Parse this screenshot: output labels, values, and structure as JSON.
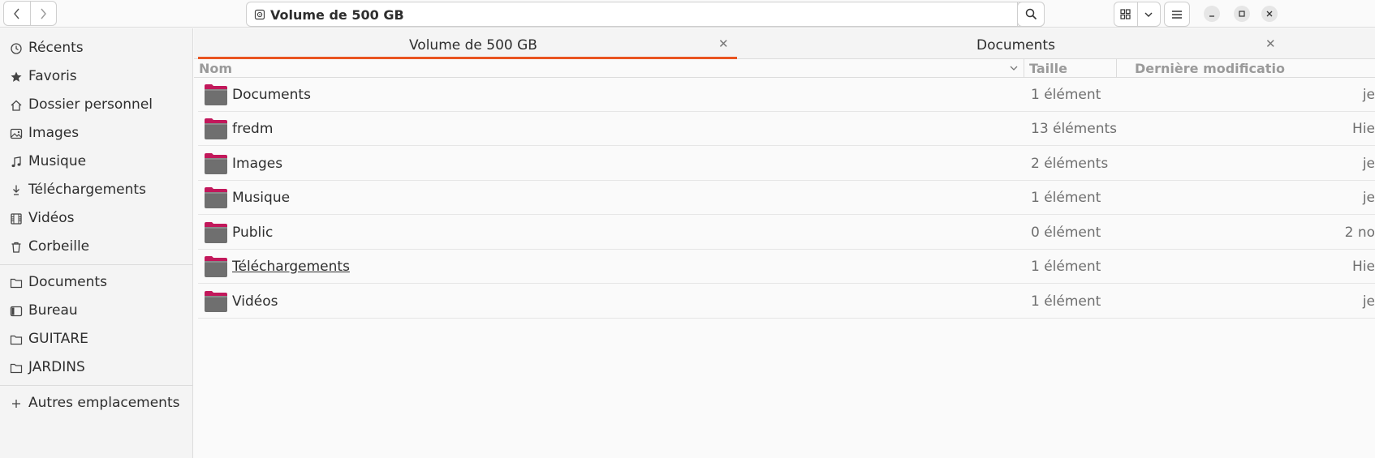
{
  "headerbar": {
    "path_label": "Volume de 500 GB"
  },
  "sidebar": {
    "items": [
      {
        "label": "Récents",
        "icon": "clock-icon"
      },
      {
        "label": "Favoris",
        "icon": "star-icon"
      },
      {
        "label": "Dossier personnel",
        "icon": "home-icon"
      },
      {
        "label": "Images",
        "icon": "image-icon"
      },
      {
        "label": "Musique",
        "icon": "music-icon"
      },
      {
        "label": "Téléchargements",
        "icon": "download-icon"
      },
      {
        "label": "Vidéos",
        "icon": "film-icon"
      },
      {
        "label": "Corbeille",
        "icon": "trash-icon"
      }
    ],
    "bookmarks": [
      {
        "label": "Documents",
        "icon": "folder-icon"
      },
      {
        "label": "Bureau",
        "icon": "desktop-icon"
      },
      {
        "label": "GUITARE",
        "icon": "folder-icon"
      },
      {
        "label": "JARDINS",
        "icon": "folder-icon"
      }
    ],
    "other_locations": {
      "label": "Autres emplacements",
      "icon": "plus-icon"
    }
  },
  "tabs": [
    {
      "label": "Volume de 500 GB",
      "active": true
    },
    {
      "label": "Documents",
      "active": false
    }
  ],
  "columns": {
    "name": "Nom",
    "size": "Taille",
    "modified": "Dernière modificatio"
  },
  "files": [
    {
      "name": "Documents",
      "size": "1 élément",
      "modified": "je"
    },
    {
      "name": "fredm",
      "size": "13 éléments",
      "modified": "Hie"
    },
    {
      "name": "Images",
      "size": "2 éléments",
      "modified": "je"
    },
    {
      "name": "Musique",
      "size": "1 élément",
      "modified": "je"
    },
    {
      "name": "Public",
      "size": "0 élément",
      "modified": "2 no"
    },
    {
      "name": "Téléchargements",
      "size": "1 élément",
      "modified": "Hie"
    },
    {
      "name": "Vidéos",
      "size": "1 élément",
      "modified": "je"
    }
  ],
  "colors": {
    "accent": "#e95420",
    "folder_body": "#6f6f6f",
    "folder_tab": "#c2185b"
  }
}
